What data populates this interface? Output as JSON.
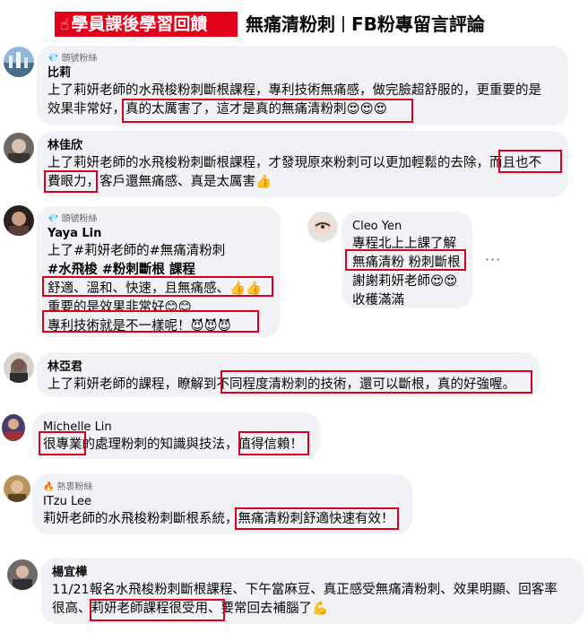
{
  "header": {
    "badge_icon": "☝",
    "badge_text": "學員課後學習回饋",
    "title_left": "無痛清粉刺",
    "title_right": "FB粉專留言評論"
  },
  "comments": [
    {
      "badge": "頭號粉絲",
      "name": "比莉",
      "line1": "上了莉妍老師的水飛梭粉刺斷根課程，專利技術無痛感，做完臉超舒服的，更重要的是",
      "line2": "效果非常好，真的太厲害了，這才是真的無痛清粉刺😍😍😍"
    },
    {
      "badge": "",
      "name": "林佳欣",
      "line1": "上了莉妍老師的水飛梭粉刺斷根課程，才發現原來粉刺可以更加輕鬆的去除，而且也不",
      "line2": "費眼力，客戶還無痛感、真是太厲害👍"
    },
    {
      "badge": "頭號粉絲",
      "name": "Yaya Lin",
      "line1": "上了#莉妍老師的#無痛清粉刺",
      "line2": "#水飛梭 #粉刺斷根 課程",
      "line3": "舒適、溫和、快速，且無痛感、👍👍",
      "line4": "重要的是效果非常好😊😊",
      "line5": "專利技術就是不一樣呢！😈😈😈"
    },
    {
      "badge": "",
      "name": "Cleo Yen",
      "line1": "專程北上上課了解",
      "line2": "無痛清粉 粉刺斷根",
      "line3": "謝謝莉妍老師😍😍",
      "line4": "收穫滿滿"
    },
    {
      "badge": "",
      "name": "林亞君",
      "line1": "上了莉妍老師的課程，瞭解到不同程度清粉刺的技術，還可以斷根，真的好強喔。"
    },
    {
      "badge": "",
      "name": "Michelle Lin",
      "line1": "很專業的處理粉刺的知識與技法，值得信賴！"
    },
    {
      "badge": "熱衷粉絲",
      "name": "ITzu Lee",
      "line1": "莉妍老師的水飛梭粉刺斷根系統，無痛清粉刺舒適快速有效！"
    },
    {
      "badge": "",
      "name": "楊宜樺",
      "line1": "11/21報名水飛梭粉刺斷根課程、下午當麻豆、真正感受無痛清粉刺、效果明顯、回客率",
      "line2": "很高、莉妍老師課程很受用、要常回去補腦了💪"
    }
  ],
  "more_icon": "···",
  "colors": {
    "accent": "#e3001b",
    "highlight": "#d8001c",
    "bubble": "#f0f2f5",
    "meta": "#65676b"
  }
}
